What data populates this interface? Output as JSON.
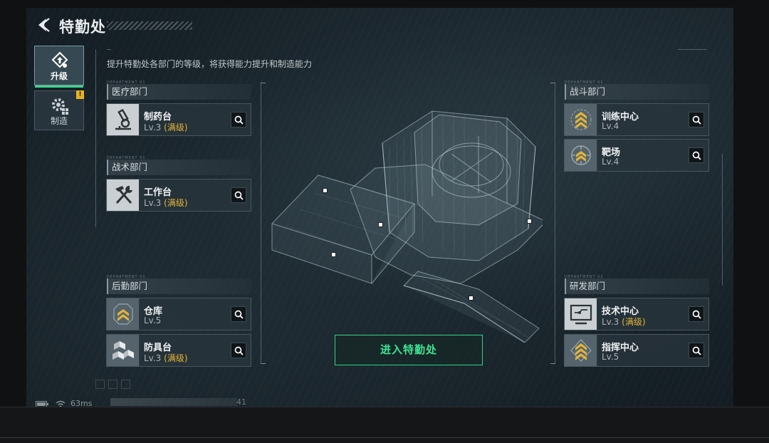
{
  "header": {
    "title": "特勤处"
  },
  "tabs": [
    {
      "label": "升级",
      "icon": "upgrade-icon",
      "active": true
    },
    {
      "label": "制造",
      "icon": "gear-icon",
      "active": false,
      "badge": "!"
    }
  ],
  "subtitle": "提升特勤处各部门的等级，将获得能力提升和制造能力",
  "departments": {
    "medical": {
      "label": "医疗部门",
      "items": [
        {
          "name": "制药台",
          "level": "Lv.3",
          "max": "(满级)",
          "icon": "microscope-icon"
        }
      ]
    },
    "tactical": {
      "label": "战术部门",
      "items": [
        {
          "name": "工作台",
          "level": "Lv.3",
          "max": "(满级)",
          "icon": "tools-icon"
        }
      ]
    },
    "logistics": {
      "label": "后勤部门",
      "items": [
        {
          "name": "仓库",
          "level": "Lv.5",
          "max": "",
          "icon": "chevron-rank-icon"
        },
        {
          "name": "防具台",
          "level": "Lv.3",
          "max": "(满级)",
          "icon": "boxes-icon"
        }
      ]
    },
    "combat": {
      "label": "战斗部门",
      "items": [
        {
          "name": "训练中心",
          "level": "Lv.4",
          "max": "",
          "icon": "chevron-rank-icon"
        },
        {
          "name": "靶场",
          "level": "Lv.4",
          "max": "",
          "icon": "target-rank-icon"
        }
      ]
    },
    "research": {
      "label": "研发部门",
      "items": [
        {
          "name": "技术中心",
          "level": "Lv.3",
          "max": "(满级)",
          "icon": "computer-icon"
        },
        {
          "name": "指挥中心",
          "level": "Lv.5",
          "max": "",
          "icon": "chevron-rank-icon"
        }
      ]
    }
  },
  "tiny_label": "DEPARTMENT 01",
  "enter_button": "进入特勤处",
  "status": {
    "ping": "63ms",
    "number": "41"
  },
  "colors": {
    "accent": "#3ee394",
    "max_level": "#e2b43a",
    "badge": "#e8b21f"
  }
}
